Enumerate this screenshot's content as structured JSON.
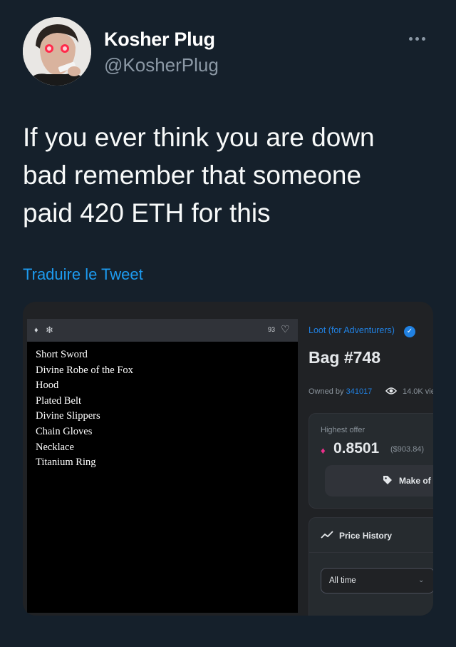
{
  "author": {
    "display_name": "Kosher Plug",
    "handle": "@KosherPlug"
  },
  "tweet": {
    "text_lines": [
      "If you ever think you are down",
      "bad remember that someone",
      "paid 420 ETH for this"
    ],
    "translate_label": "Traduire le Tweet"
  },
  "nft_card": {
    "favorite_count": "93",
    "items": [
      "Short Sword",
      "Divine Robe of the Fox",
      "Hood",
      "Plated Belt",
      "Divine Slippers",
      "Chain Gloves",
      "Necklace",
      "Titanium Ring"
    ],
    "collection_name": "Loot (for Adventurers)",
    "title": "Bag #748",
    "owned_by_label": "Owned by",
    "owner": "341017",
    "views": "14.0K vie",
    "highest_offer_label": "Highest offer",
    "highest_offer_price": "0.8501",
    "highest_offer_usd": "($903.84)",
    "make_offer_label": "Make of",
    "price_history_label": "Price History",
    "time_filter_value": "All time"
  },
  "colors": {
    "background": "#15202b",
    "link": "#1d9bf0",
    "opensea_blue": "#2081e2",
    "eth_pink": "#ec2f8b"
  }
}
